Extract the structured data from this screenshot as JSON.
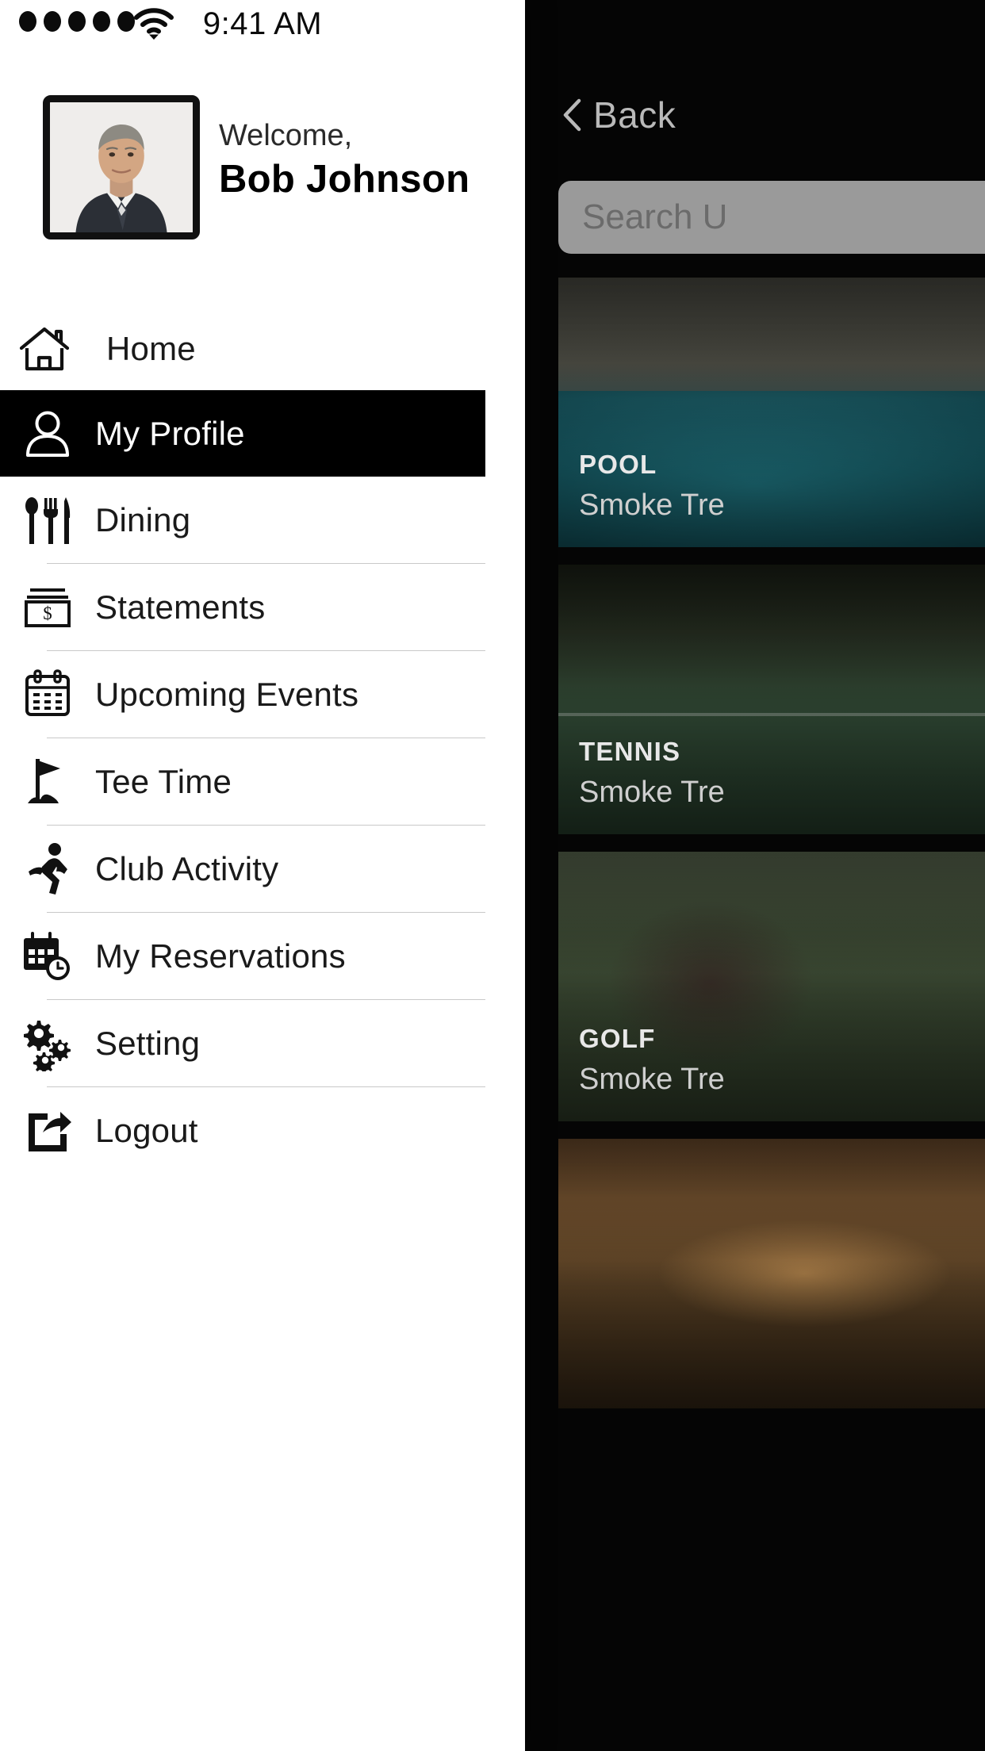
{
  "status_bar": {
    "signal_dots": 5,
    "wifi_icon": "wifi-icon",
    "time": "9:41 AM"
  },
  "drawer": {
    "profile": {
      "avatar_icon": "user-photo-avatar",
      "welcome_label": "Welcome,",
      "user_name": "Bob Johnson"
    },
    "menu": [
      {
        "label": "Home",
        "icon": "home-icon",
        "active": false
      },
      {
        "label": "My Profile",
        "icon": "person-icon",
        "active": true
      },
      {
        "label": "Dining",
        "icon": "cutlery-icon",
        "active": false
      },
      {
        "label": "Statements",
        "icon": "money-dollar-icon",
        "active": false
      },
      {
        "label": "Upcoming Events",
        "icon": "calendar-icon",
        "active": false
      },
      {
        "label": "Tee Time",
        "icon": "golf-flag-icon",
        "active": false
      },
      {
        "label": "Club Activity",
        "icon": "runner-icon",
        "active": false
      },
      {
        "label": "My Reservations",
        "icon": "calendar-clock-icon",
        "active": false
      },
      {
        "label": "Setting",
        "icon": "gears-icon",
        "active": false
      },
      {
        "label": "Logout",
        "icon": "logout-icon",
        "active": false
      }
    ]
  },
  "underlay": {
    "back_button": {
      "label": "Back",
      "icon": "chevron-left-icon"
    },
    "search": {
      "placeholder": "Search U"
    },
    "cards": [
      {
        "category": "POOL",
        "subtitle": "Smoke Tre",
        "photo": "pool-photo"
      },
      {
        "category": "TENNIS",
        "subtitle": "Smoke Tre",
        "photo": "tennis-photo"
      },
      {
        "category": "GOLF",
        "subtitle": "Smoke Tre",
        "photo": "golf-photo"
      },
      {
        "category": "",
        "subtitle": "",
        "photo": "lodge-photo"
      }
    ]
  },
  "colors": {
    "drawer_bg": "#ffffff",
    "active_bg": "#000000",
    "active_text": "#ffffff",
    "underlay_bg": "#050505",
    "search_bg": "#9a9a9a",
    "divider": "#c9c9c9"
  }
}
